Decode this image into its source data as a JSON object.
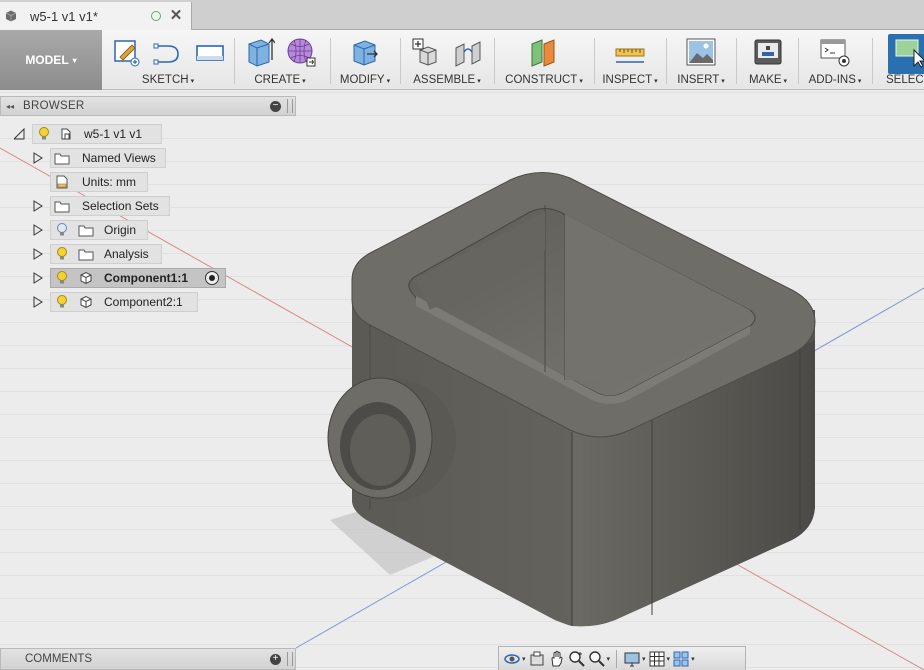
{
  "document_tab": {
    "title": "w5-1 v1 v1*",
    "icon": "document-cube-icon",
    "saved_status_icon": "circle-status-icon",
    "close_icon": "close-icon"
  },
  "toolbar": {
    "workspace": {
      "label": "MODEL",
      "caret": "▾"
    },
    "groups": [
      {
        "id": "sketch",
        "label": "SKETCH",
        "icons": [
          "create-sketch-icon",
          "arc-line-icon",
          "rectangle-icon"
        ]
      },
      {
        "id": "create",
        "label": "CREATE",
        "icons": [
          "extrude-icon",
          "freeform-sphere-icon"
        ]
      },
      {
        "id": "modify",
        "label": "MODIFY",
        "icons": [
          "press-pull-icon"
        ]
      },
      {
        "id": "assemble",
        "label": "ASSEMBLE",
        "icons": [
          "new-component-icon",
          "joint-icon"
        ]
      },
      {
        "id": "construct",
        "label": "CONSTRUCT",
        "icons": [
          "offset-plane-icon"
        ]
      },
      {
        "id": "inspect",
        "label": "INSPECT",
        "icons": [
          "measure-icon"
        ]
      },
      {
        "id": "insert",
        "label": "INSERT",
        "icons": [
          "insert-image-icon"
        ]
      },
      {
        "id": "make",
        "label": "MAKE",
        "icons": [
          "3d-print-icon"
        ]
      },
      {
        "id": "addins",
        "label": "ADD-INS",
        "icons": [
          "scripts-addins-icon"
        ]
      },
      {
        "id": "select",
        "label": "SELECT",
        "icons": [
          "select-icon"
        ]
      }
    ],
    "caret": "▾"
  },
  "browser": {
    "title": "BROWSER",
    "collapse_glyph": "◂◂",
    "minus_glyph": "−",
    "nodes": [
      {
        "id": "root",
        "label": "w5-1 v1 v1",
        "expander": "expanded",
        "bulb": true,
        "icon": "document-icon"
      },
      {
        "id": "named-views",
        "label": "Named Views",
        "expander": "collapsed",
        "bulb": false,
        "icon": "folder-icon"
      },
      {
        "id": "units",
        "label": "Units: mm",
        "expander": "none",
        "bulb": false,
        "icon": "units-icon"
      },
      {
        "id": "selection-sets",
        "label": "Selection Sets",
        "expander": "collapsed",
        "bulb": false,
        "icon": "folder-icon"
      },
      {
        "id": "origin",
        "label": "Origin",
        "expander": "collapsed",
        "bulb": "off",
        "icon": "folder-icon"
      },
      {
        "id": "analysis",
        "label": "Analysis",
        "expander": "collapsed",
        "bulb": true,
        "icon": "folder-icon"
      },
      {
        "id": "component1",
        "label": "Component1:1",
        "expander": "collapsed",
        "bulb": true,
        "icon": "component-icon",
        "selected": true,
        "active_radio": true
      },
      {
        "id": "component2",
        "label": "Component2:1",
        "expander": "collapsed",
        "bulb": true,
        "icon": "component-icon"
      }
    ]
  },
  "comments": {
    "title": "COMMENTS",
    "plus_glyph": "+"
  },
  "navbar": {
    "items": [
      "orbit-icon",
      "look-at-icon",
      "pan-icon",
      "zoom-icon",
      "zoom-window-icon",
      "display-settings-icon",
      "grid-icon",
      "viewports-icon"
    ]
  },
  "colors": {
    "toolbar_bg": "#efefef",
    "workspace_bg": "#9a9a9a",
    "model_body": "#5e5d58",
    "model_top": "#6a6963",
    "grid_line": "#cfcfcf",
    "axis_red": "#d88080",
    "axis_blue": "#7d8fd8",
    "select_blue": "#2a6fb0"
  }
}
